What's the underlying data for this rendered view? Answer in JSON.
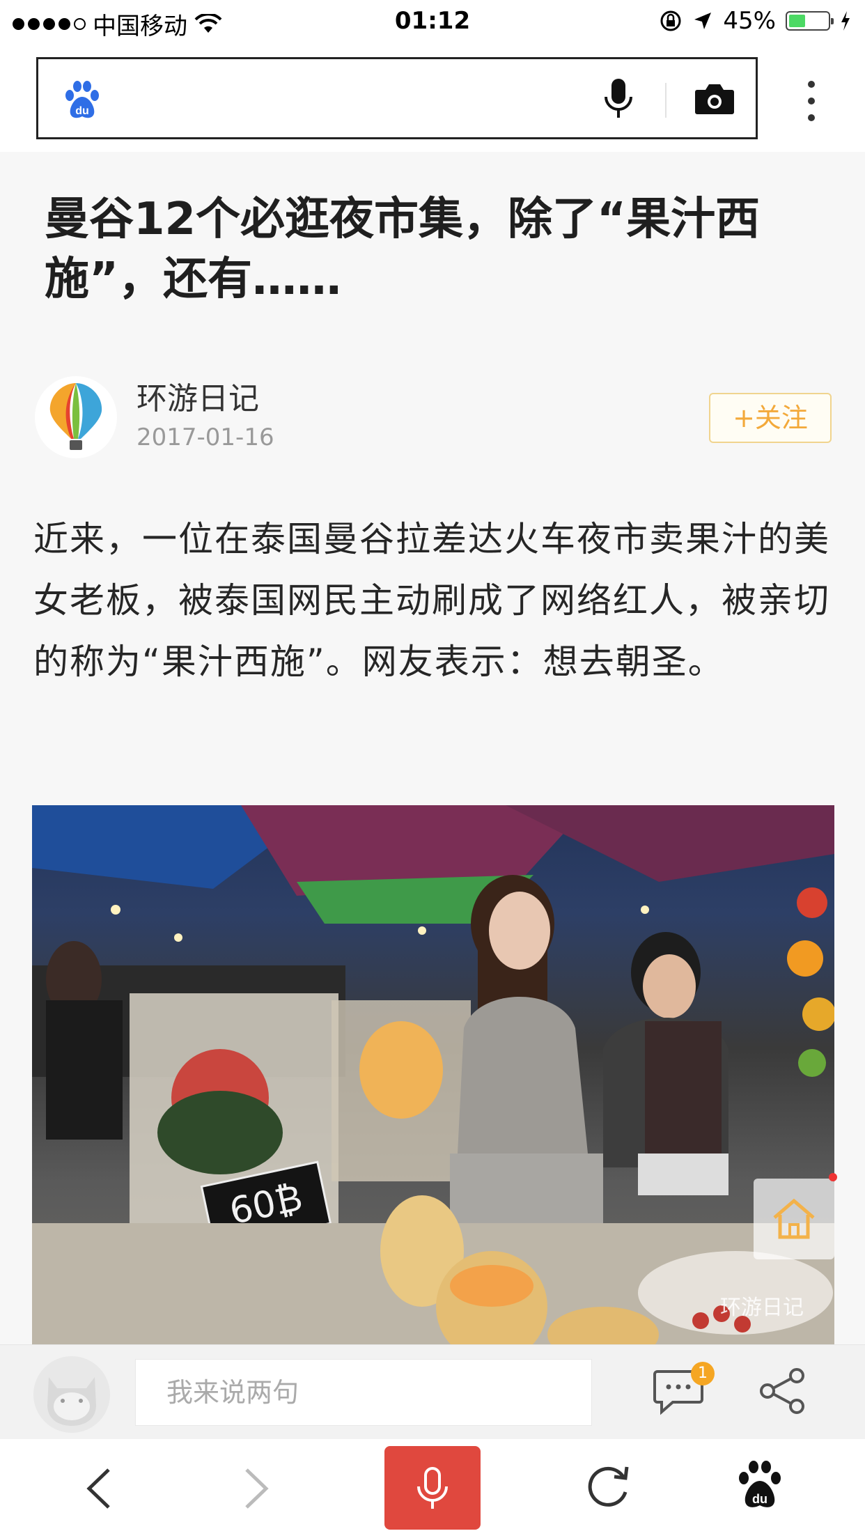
{
  "status_bar": {
    "carrier": "中国移动",
    "time": "01:12",
    "battery": "45%",
    "battery_level": 0.45
  },
  "search": {
    "logo_text": "du"
  },
  "article": {
    "title": "曼谷12个必逛夜市集，除了“果汁西施”，还有……",
    "author": {
      "name": "环游日记",
      "date": "2017-01-16"
    },
    "follow_label": "+关注",
    "paragraph": "近来，一位在泰国曼谷拉差达火车夜市卖果汁的美女老板，被泰国网民主动刷成了网络红人，被亲切的称为“果汁西施”。网友表示：想去朝圣。",
    "image": {
      "price_tag": "60₿",
      "watermark": "环游日记"
    }
  },
  "comment_bar": {
    "placeholder": "我来说两句",
    "badge_count": "1"
  },
  "browser_nav": {
    "home_logo_text": "du"
  },
  "colors": {
    "accent_follow": "#f3a93a",
    "voice_button": "#e0483e",
    "badge": "#f5a623",
    "baidu_blue": "#2f6ee6"
  }
}
